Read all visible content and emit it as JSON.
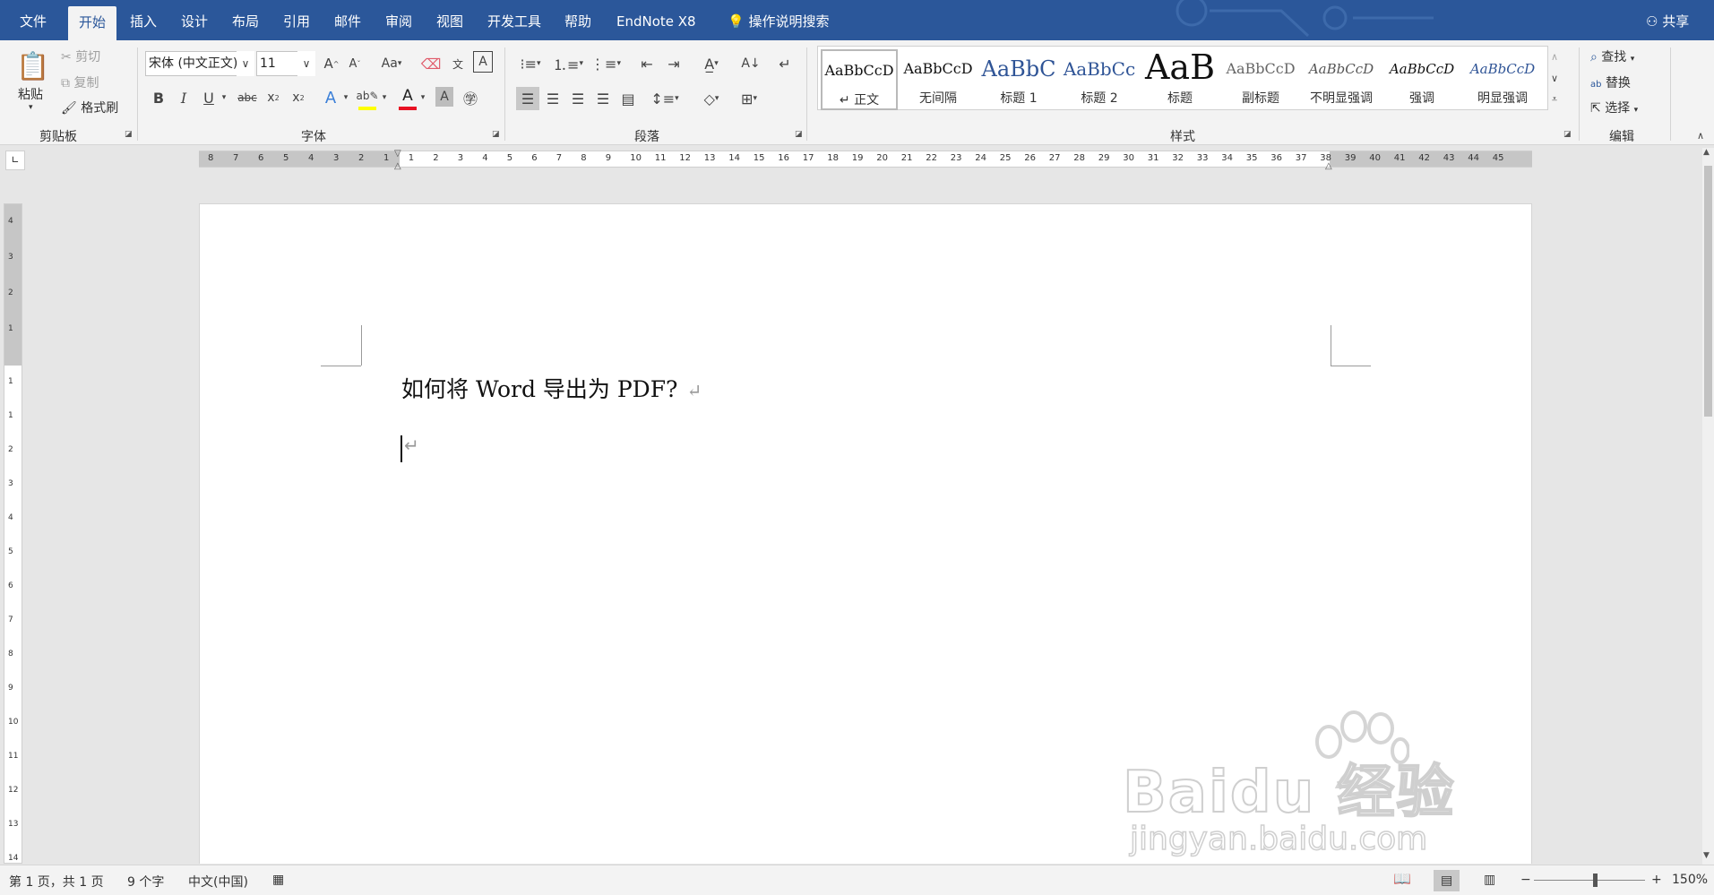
{
  "tabs": [
    "文件",
    "开始",
    "插入",
    "设计",
    "布局",
    "引用",
    "邮件",
    "审阅",
    "视图",
    "开发工具",
    "帮助",
    "EndNote X8"
  ],
  "tell_me": "操作说明搜索",
  "share": "共享",
  "clipboard": {
    "paste": "粘贴",
    "cut": "剪切",
    "copy": "复制",
    "format_painter": "格式刷",
    "label": "剪贴板"
  },
  "font": {
    "name": "宋体 (中文正文)",
    "size": "11",
    "label": "字体",
    "case_btn": "Aa"
  },
  "paragraph": {
    "label": "段落"
  },
  "styles": {
    "label": "样式",
    "items": [
      {
        "preview": "AaBbCcD",
        "name": "↵ 正文"
      },
      {
        "preview": "AaBbCcD",
        "name": "无间隔"
      },
      {
        "preview": "AaBbC",
        "name": "标题 1"
      },
      {
        "preview": "AaBbCc",
        "name": "标题 2"
      },
      {
        "preview": "AaB",
        "name": "标题"
      },
      {
        "preview": "AaBbCcD",
        "name": "副标题"
      },
      {
        "preview": "AaBbCcD",
        "name": "不明显强调"
      },
      {
        "preview": "AaBbCcD",
        "name": "强调"
      },
      {
        "preview": "AaBbCcD",
        "name": "明显强调"
      }
    ]
  },
  "editing": {
    "find": "查找",
    "replace": "替换",
    "select": "选择",
    "label": "编辑"
  },
  "ruler_left": [
    "8",
    "7",
    "6",
    "5",
    "4",
    "3",
    "2",
    "1"
  ],
  "ruler_right": [
    "1",
    "2",
    "3",
    "4",
    "5",
    "6",
    "7",
    "8",
    "9",
    "10",
    "11",
    "12",
    "13",
    "14",
    "15",
    "16",
    "17",
    "18",
    "19",
    "20",
    "21",
    "22",
    "23",
    "24",
    "25",
    "26",
    "27",
    "28",
    "29",
    "30",
    "31",
    "32",
    "33",
    "34",
    "35",
    "36",
    "37",
    "38",
    "39",
    "40",
    "41",
    "42",
    "43",
    "44",
    "45"
  ],
  "vruler_top": [
    "4",
    "3",
    "2",
    "1"
  ],
  "vruler_bottom": [
    "1",
    "1",
    "2",
    "3",
    "4",
    "5",
    "6",
    "7",
    "8",
    "9",
    "10",
    "11",
    "12",
    "13",
    "14"
  ],
  "document": {
    "line1": "如何将 Word 导出为 PDF?",
    "para_mark": "↵"
  },
  "status": {
    "page": "第 1 页，共 1 页",
    "words": "9 个字",
    "lang": "中文(中国)",
    "zoom": "150%"
  },
  "watermark": {
    "logo": "Baidu 经验",
    "url": "jingyan.baidu.com"
  },
  "colors": {
    "brand": "#2b579a",
    "font_color_bar": "#e81123",
    "highlight_bar": "#ffff00"
  }
}
